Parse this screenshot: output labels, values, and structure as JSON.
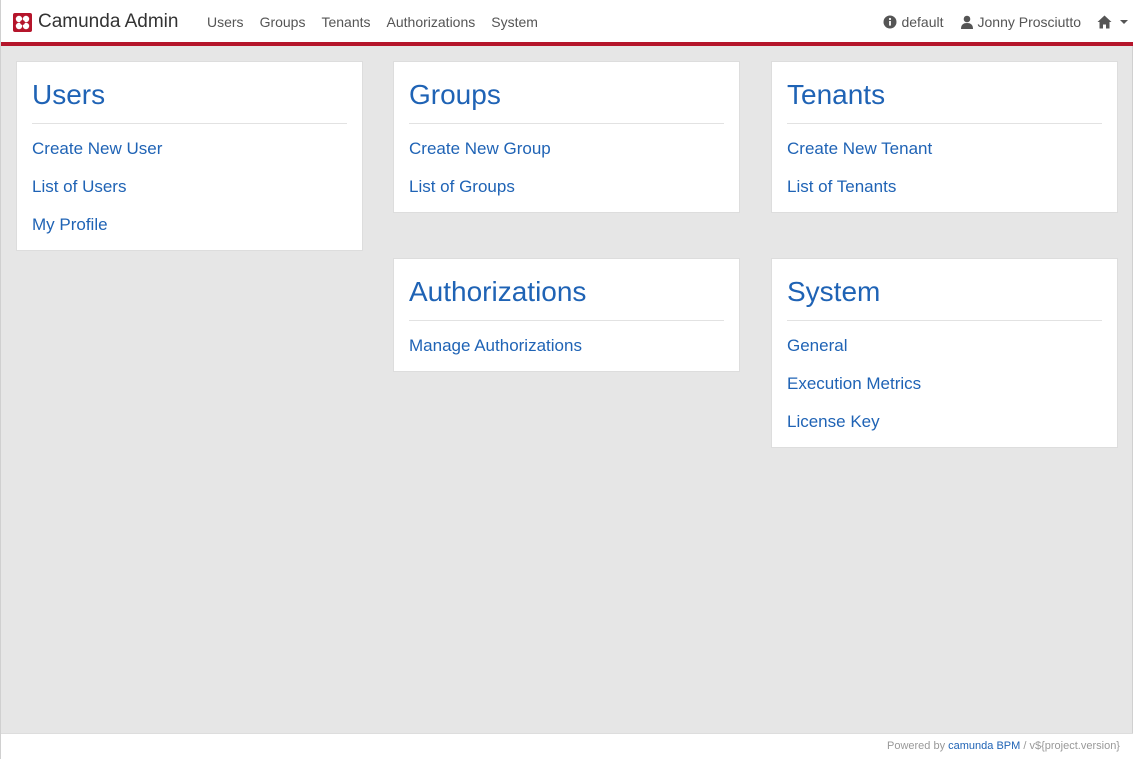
{
  "app": {
    "brand_name": "Camunda Admin",
    "brand_icon": "camunda-logo-icon",
    "accent_color": "#b5152b",
    "link_color": "#1f63b5"
  },
  "nav": {
    "items": [
      {
        "label": "Users"
      },
      {
        "label": "Groups"
      },
      {
        "label": "Tenants"
      },
      {
        "label": "Authorizations"
      },
      {
        "label": "System"
      }
    ],
    "engine": {
      "icon": "info-circle-icon",
      "label": "default"
    },
    "user": {
      "icon": "user-icon",
      "label": "Jonny Prosciutto"
    },
    "home": {
      "icon": "home-icon"
    }
  },
  "sections": {
    "users": {
      "title": "Users",
      "links": [
        "Create New User",
        "List of Users",
        "My Profile"
      ]
    },
    "groups": {
      "title": "Groups",
      "links": [
        "Create New Group",
        "List of Groups"
      ]
    },
    "tenants": {
      "title": "Tenants",
      "links": [
        "Create New Tenant",
        "List of Tenants"
      ]
    },
    "authorizations": {
      "title": "Authorizations",
      "links": [
        "Manage Authorizations"
      ]
    },
    "system": {
      "title": "System",
      "links": [
        "General",
        "Execution Metrics",
        "License Key"
      ]
    }
  },
  "footer": {
    "powered_by": "Powered by",
    "product_link": "camunda BPM",
    "version": "/ v${project.version}"
  }
}
